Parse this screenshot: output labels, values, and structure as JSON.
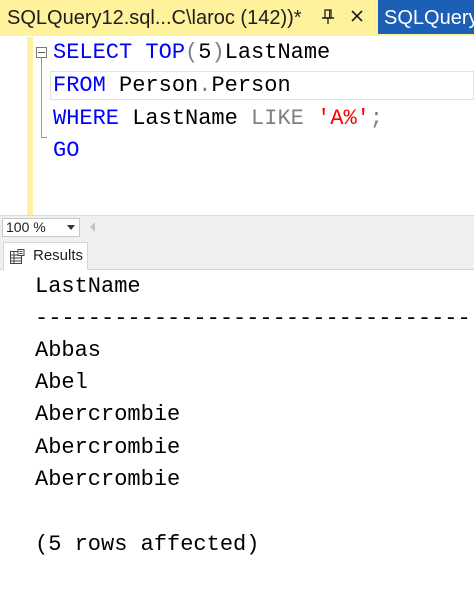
{
  "tabs": {
    "active_title": "SQLQuery12.sql...C\\laroc (142))*",
    "inactive_title": "SQLQuery"
  },
  "editor": {
    "lines": [
      [
        {
          "text": "SELECT",
          "type": "keyword"
        },
        {
          "text": " TOP",
          "type": "keyword"
        },
        {
          "text": "(",
          "type": "operator"
        },
        {
          "text": "5",
          "type": "text"
        },
        {
          "text": ")",
          "type": "operator"
        },
        {
          "text": "LastName",
          "type": "text"
        }
      ],
      [
        {
          "text": "FROM",
          "type": "keyword"
        },
        {
          "text": " Person",
          "type": "text"
        },
        {
          "text": ".",
          "type": "operator"
        },
        {
          "text": "Person",
          "type": "text"
        }
      ],
      [
        {
          "text": "WHERE",
          "type": "keyword"
        },
        {
          "text": " LastName ",
          "type": "text"
        },
        {
          "text": "LIKE",
          "type": "operator"
        },
        {
          "text": " ",
          "type": "text"
        },
        {
          "text": "'A%'",
          "type": "string"
        },
        {
          "text": ";",
          "type": "operator"
        }
      ],
      [
        {
          "text": "GO",
          "type": "keyword"
        }
      ]
    ]
  },
  "zoom": {
    "value": "100 %"
  },
  "results": {
    "tab_label": "Results",
    "column_header": "LastName",
    "separator": "--------------------------------------------------",
    "rows": [
      "Abbas",
      "Abel",
      "Abercrombie",
      "Abercrombie",
      "Abercrombie"
    ],
    "message": "(5 rows affected)"
  },
  "colors": {
    "keyword": "#0000ff",
    "string": "#ff0000",
    "operator": "#808080",
    "active_tab_bg": "#fff29d",
    "inactive_tab_bg": "#1c5fb6"
  },
  "icons": {
    "pin": "pin-icon",
    "close": "close-icon",
    "results": "results-grid-icon",
    "dropdown": "chevron-down-icon",
    "scroll_left": "scroll-left-icon",
    "outline_collapse": "outline-collapse-icon"
  }
}
